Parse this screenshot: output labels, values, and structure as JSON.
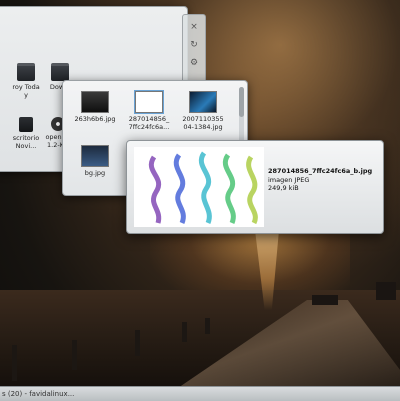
{
  "file_manager": {
    "items": [
      {
        "label": "roy Toda\ny",
        "icon": "folder-icon"
      },
      {
        "label": "Downl",
        "icon": "folder-icon"
      },
      {
        "label": "scritorio\nNovi...",
        "icon": "document-icon"
      },
      {
        "label": "openSU\n1.2-KD",
        "icon": "disc-icon"
      }
    ],
    "side_controls": [
      "close-icon",
      "restore-icon",
      "settings-icon"
    ]
  },
  "popup": {
    "files": [
      {
        "name": "263h6b6.jpg",
        "thumb": "black"
      },
      {
        "name": "287014856_\n7ffc24fc6a...",
        "thumb": "smoke",
        "selected": true
      },
      {
        "name": "2007110355\n04-1384.jpg",
        "thumb": "blue"
      },
      {
        "name": "bg.jpg",
        "thumb": "bg"
      }
    ]
  },
  "tooltip": {
    "filename": "287014856_7ffc24fc6a_b.jpg",
    "type": "imagen JPEG",
    "size": "249,9 kiB"
  },
  "taskbar": {
    "task_label": "s (20) - favidalinux..."
  },
  "colors": {
    "window_bg": "#e6e9eb",
    "selection": "#6aa3d5",
    "smoke_colors": [
      "#7a3fb0",
      "#3c5bd6",
      "#2fb5c9",
      "#3fbf6a",
      "#a8c93a"
    ]
  }
}
